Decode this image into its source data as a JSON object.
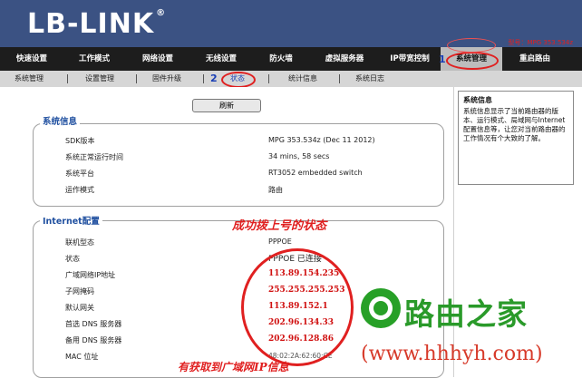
{
  "header": {
    "logo": "LB-LINK",
    "registered_mark": "®",
    "model": "型号：MPG 353.534z"
  },
  "nav": [
    {
      "label": "快速设置"
    },
    {
      "label": "工作模式"
    },
    {
      "label": "网络设置"
    },
    {
      "label": "无线设置"
    },
    {
      "label": "防火墙"
    },
    {
      "label": "虚拟服务器"
    },
    {
      "label": "IP带宽控制"
    },
    {
      "label": "系统管理",
      "active": true
    },
    {
      "label": "重启路由"
    }
  ],
  "subnav": [
    {
      "label": "系统管理"
    },
    {
      "label": "设置管理"
    },
    {
      "label": "固件升级"
    },
    {
      "label": "状态",
      "active": true
    },
    {
      "label": "统计信息"
    },
    {
      "label": "系统日志"
    }
  ],
  "annotations": {
    "num1": "1",
    "num2": "2"
  },
  "refresh_label": "刷新",
  "system_info": {
    "title": "系统信息",
    "rows": [
      {
        "label": "SDK版本",
        "value": "MPG 353.534z (Dec 11 2012)"
      },
      {
        "label": "系统正常运行时间",
        "value": "34 mins, 58 secs"
      },
      {
        "label": "系统平台",
        "value": "RT3052 embedded switch"
      },
      {
        "label": "运作模式",
        "value": "路由"
      }
    ]
  },
  "internet": {
    "title": "Internet配置",
    "rows": [
      {
        "label": "联机型态",
        "value": "PPPOE"
      },
      {
        "label": "状态",
        "value": "PPPOE 已连接"
      },
      {
        "label": "广域网络IP地址",
        "value": "113.89.154.235"
      },
      {
        "label": "子网掩码",
        "value": "255.255.255.253"
      },
      {
        "label": "默认网关",
        "value": "113.89.152.1"
      },
      {
        "label": "首选 DNS 服务器",
        "value": "202.96.134.33"
      },
      {
        "label": "备用 DNS 服务器",
        "value": "202.96.128.86"
      },
      {
        "label": "MAC 位址",
        "value": "48:02:2A:62:60:CE"
      }
    ]
  },
  "notes": {
    "success": "成功拨上号的状态",
    "wan": "有获取到广域网IP信息"
  },
  "sidebar": {
    "title": "系统信息",
    "text": "系统信息显示了当前路由器的版本、运行模式、局域网与Internet配置信息等，让您对当前路由器的工作情况有个大致的了解。"
  },
  "watermark": {
    "title": "路由之家",
    "url": "(www.hhhyh.com)"
  }
}
